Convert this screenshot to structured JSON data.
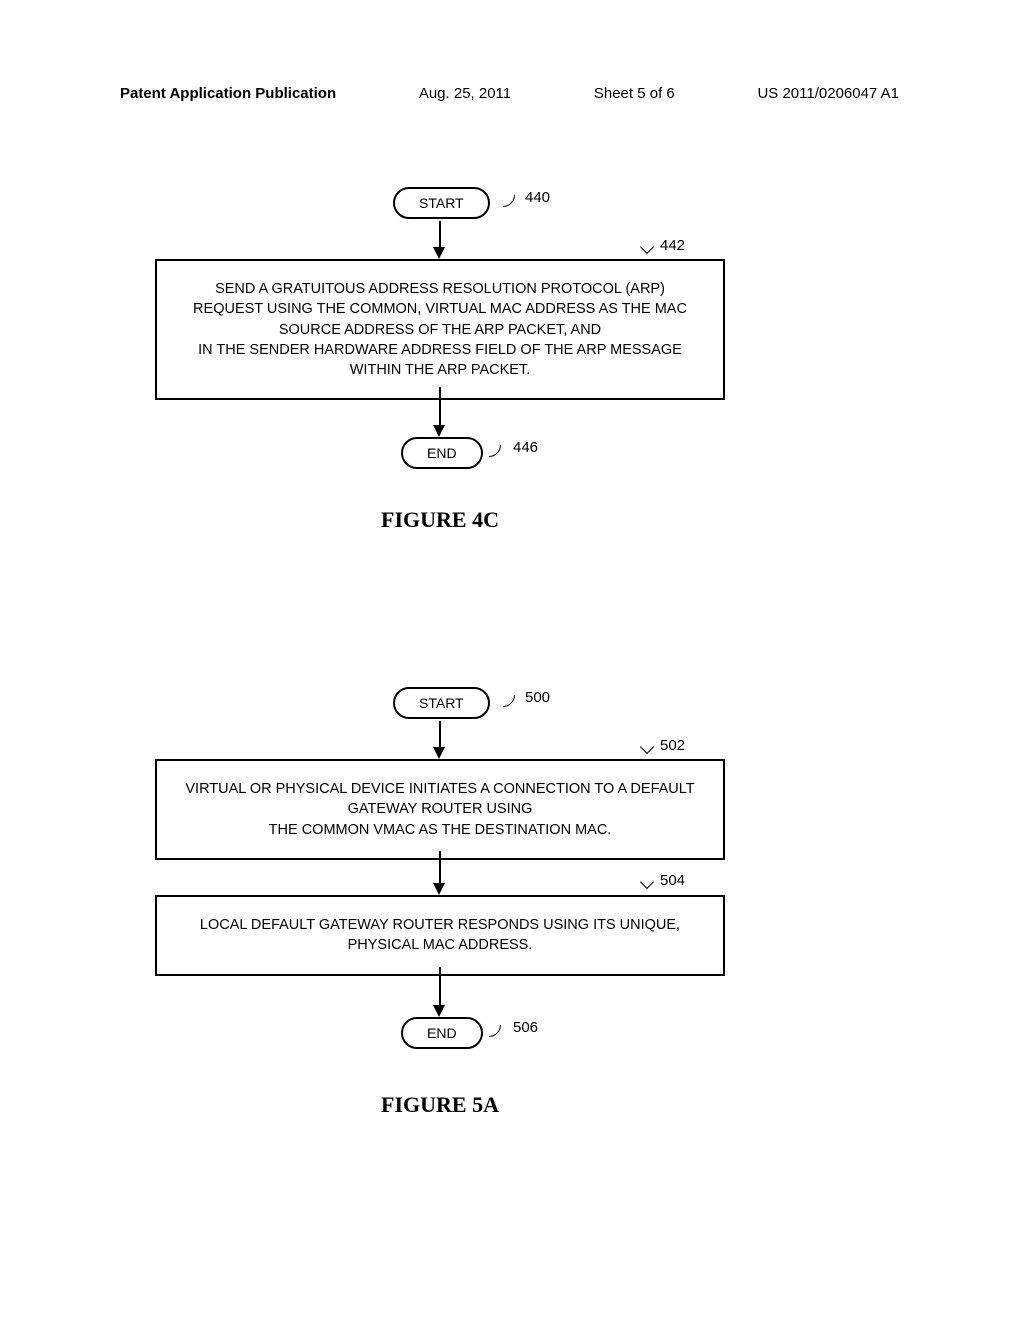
{
  "header": {
    "left": "Patent Application Publication",
    "date": "Aug. 25, 2011",
    "sheet": "Sheet 5 of 6",
    "pubnum": "US 2011/0206047 A1"
  },
  "fig4c": {
    "start": "START",
    "start_ref": "440",
    "box1_ref": "442",
    "box1": "SEND A GRATUITOUS ADDRESS RESOLUTION PROTOCOL (ARP) REQUEST USING THE COMMON, VIRTUAL MAC ADDRESS AS THE MAC SOURCE ADDRESS OF THE ARP PACKET, AND\nIN THE SENDER HARDWARE ADDRESS FIELD OF THE ARP MESSAGE WITHIN THE ARP PACKET.",
    "end": "END",
    "end_ref": "446",
    "title": "FIGURE 4C"
  },
  "fig5a": {
    "start": "START",
    "start_ref": "500",
    "box1_ref": "502",
    "box1": "VIRTUAL OR PHYSICAL DEVICE INITIATES A CONNECTION TO A DEFAULT GATEWAY ROUTER USING\nTHE COMMON VMAC AS THE DESTINATION MAC.",
    "box2_ref": "504",
    "box2": "LOCAL DEFAULT GATEWAY ROUTER RESPONDS USING ITS UNIQUE, PHYSICAL MAC ADDRESS.",
    "end": "END",
    "end_ref": "506",
    "title": "FIGURE 5A"
  }
}
